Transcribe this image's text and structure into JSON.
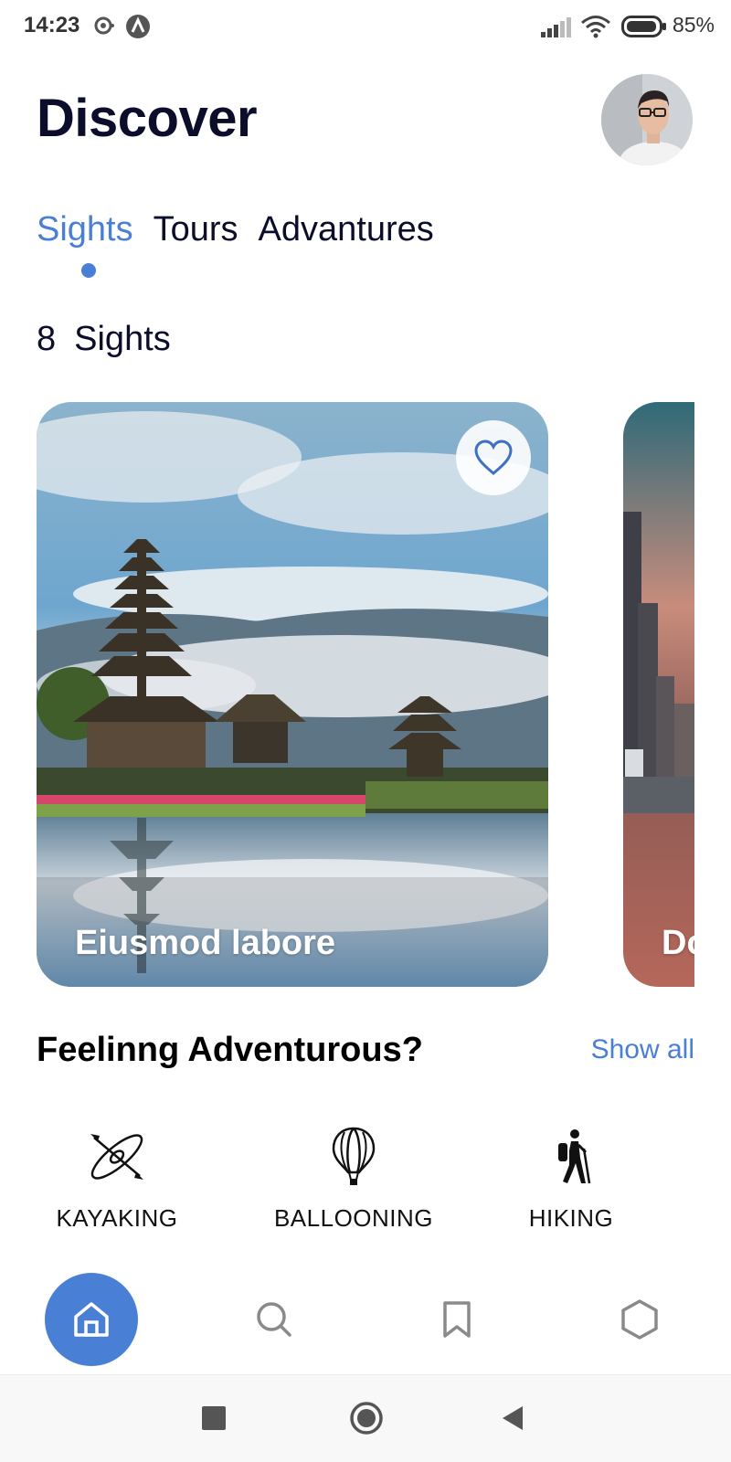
{
  "status_bar": {
    "time": "14:23",
    "battery_percent": "85%",
    "icons": [
      "sync-icon",
      "app-notification-icon",
      "signal-icon",
      "wifi-icon",
      "battery-icon"
    ]
  },
  "header": {
    "title": "Discover",
    "avatar_icon": "user-avatar"
  },
  "tabs": [
    {
      "label": "Sights",
      "active": true
    },
    {
      "label": "Tours",
      "active": false
    },
    {
      "label": "Advantures",
      "active": false
    }
  ],
  "sights_count": {
    "number": "8",
    "label": "Sights"
  },
  "cards": [
    {
      "title": "Eiusmod labore",
      "image": "temple-lake-photo",
      "favorite_icon": "heart-outline-icon"
    },
    {
      "title": "Do",
      "image": "city-street-photo"
    }
  ],
  "adventure_section": {
    "title": "Feelinng Adventurous?",
    "show_all": "Show all",
    "items": [
      {
        "label": "KAYAKING",
        "icon": "kayak-icon"
      },
      {
        "label": "BALLOONING",
        "icon": "hot-air-balloon-icon"
      },
      {
        "label": "HIKING",
        "icon": "hiker-icon"
      }
    ]
  },
  "bottom_nav": {
    "items": [
      {
        "icon": "home-icon",
        "active": true
      },
      {
        "icon": "search-icon",
        "active": false
      },
      {
        "icon": "bookmark-icon",
        "active": false
      },
      {
        "icon": "hexagon-icon",
        "active": false
      }
    ]
  },
  "system_nav": [
    "recent-apps-icon",
    "home-circle-icon",
    "back-icon"
  ],
  "colors": {
    "accent": "#4a7fd6",
    "title": "#0b0d2a",
    "background": "#ffffff"
  }
}
